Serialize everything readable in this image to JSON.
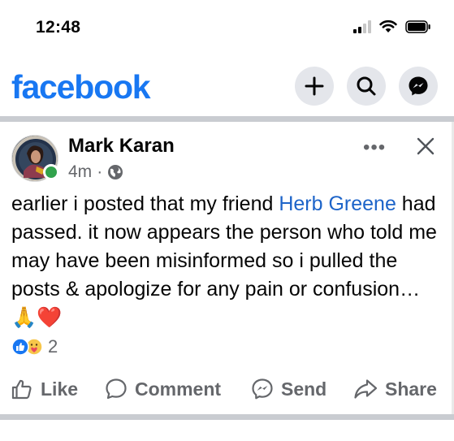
{
  "status_bar": {
    "time": "12:48"
  },
  "header": {
    "logo": "facebook",
    "buttons": [
      {
        "name": "create",
        "icon": "plus-icon"
      },
      {
        "name": "search",
        "icon": "search-icon"
      },
      {
        "name": "messenger",
        "icon": "messenger-icon"
      }
    ]
  },
  "post": {
    "author": "Mark Karan",
    "time_ago": "4m",
    "separator": "·",
    "privacy_icon": "globe-icon",
    "more_label": "•••",
    "text_before": "earlier i posted that my friend ",
    "tagged_name": "Herb Greene",
    "text_after": " had passed. it now appears the person who told me may have been misinformed so i pulled the posts & apologize for any pain or confusion… ",
    "emoji": "🙏❤️",
    "reactions": {
      "icons": [
        "like-reaction",
        "care-reaction"
      ],
      "count": "2"
    },
    "actions": {
      "like": "Like",
      "comment": "Comment",
      "send": "Send",
      "share": "Share"
    }
  },
  "colors": {
    "brand": "#1877f2",
    "link": "#1d64c9",
    "muted": "#65676b",
    "online": "#31a24c",
    "divider": "#c9ccd1"
  }
}
